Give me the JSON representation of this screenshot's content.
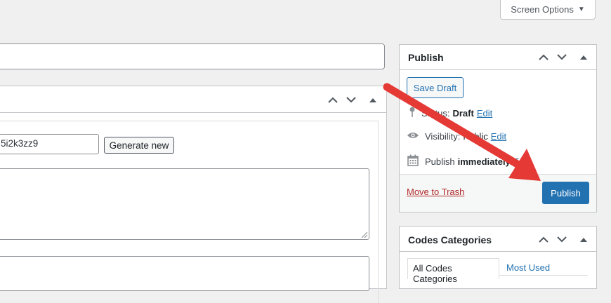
{
  "screen_options": {
    "label": "Screen Options",
    "caret_icon": "caret-down-icon"
  },
  "code_field": {
    "value": "5i2k3zz9"
  },
  "generate_button": {
    "label": "Generate new"
  },
  "publish": {
    "title": "Publish",
    "save_draft": "Save Draft",
    "status_label": "Status:",
    "status_value": "Draft",
    "status_edit": "Edit",
    "visibility_label": "Visibility:",
    "visibility_value": "Public",
    "visibility_edit": "Edit",
    "schedule_label": "Publish",
    "schedule_value": "immediately",
    "schedule_edit": "Edit",
    "trash": "Move to Trash",
    "publish_button": "Publish"
  },
  "categories": {
    "title": "Codes Categories",
    "tabs": [
      {
        "label": "All Codes Categories",
        "active": true
      },
      {
        "label": "Most Used",
        "active": false
      }
    ]
  },
  "colors": {
    "primary": "#2271b1",
    "trash": "#b32d2e",
    "annotation_arrow": "#e53935",
    "background": "#f0f0f1"
  }
}
